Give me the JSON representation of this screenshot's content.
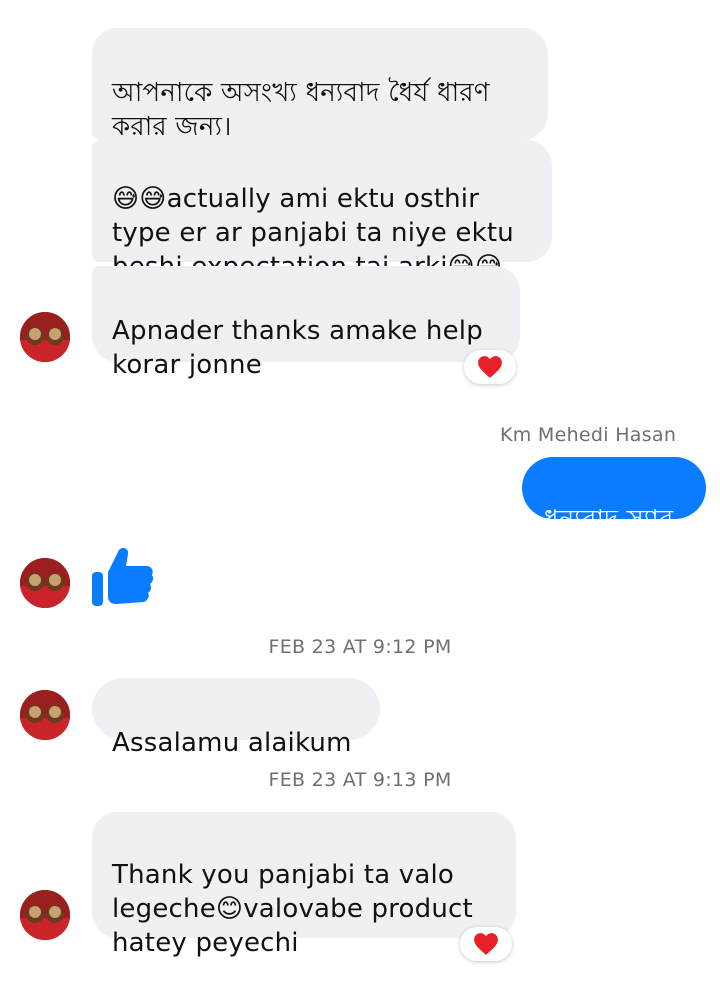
{
  "conversation": {
    "messages": [
      {
        "text": "আপনাকে অসংখ্য ধন্যবাদ ধৈর্য ধারণ\nকরার জন্য।"
      },
      {
        "text": "😅😅actually ami ektu osthir\ntype er ar panjabi ta niye ektu\nbeshi expectation tai arki😅😅"
      },
      {
        "text": "Apnader thanks amake help\nkorar jonne",
        "reaction": "heart"
      },
      {
        "sender": "Km Mehedi Hasan",
        "text": "ধন্যবাদ স্যার"
      },
      {
        "type": "like",
        "icon": "thumbs-up-icon"
      },
      {
        "timestamp": "FEB 23 AT 9:12 PM"
      },
      {
        "text": "Assalamu alaikum"
      },
      {
        "timestamp": "FEB 23 AT 9:13 PM"
      },
      {
        "text": "Thank you panjabi ta valo\nlegeche😊valovabe product\nhatey peyechi",
        "reaction": "heart"
      }
    ]
  },
  "colors": {
    "incoming_bubble": "#eff0f3",
    "outgoing_bubble": "#0a7cff",
    "like_icon": "#0a7cff",
    "heart": "#e8202a",
    "timestamp_text": "#6f6f6f"
  }
}
